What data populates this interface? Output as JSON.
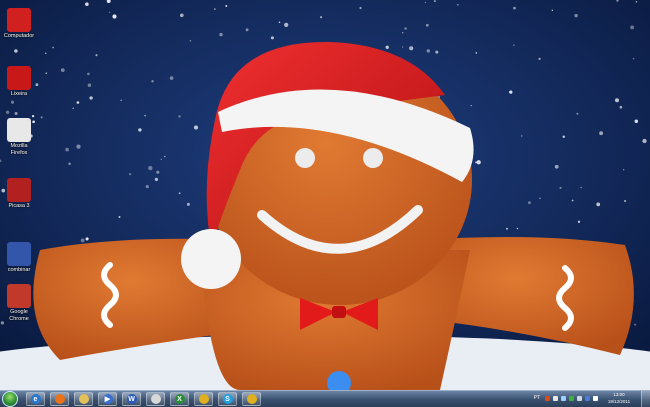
{
  "desktop": {
    "icons": [
      {
        "label": "Computador",
        "icon": "computer-icon",
        "color": "#d02020"
      },
      {
        "label": "Lixeira",
        "icon": "recycle-bin-icon",
        "color": "#c81818"
      },
      {
        "label": "Mozilla Firefox",
        "icon": "firefox-candy-cane-icon",
        "color": "#e8e8e8"
      },
      {
        "label": "Picasa 3",
        "icon": "picasa-icon",
        "color": "#b32020"
      },
      {
        "label": "combinar",
        "icon": "combinar-icon",
        "color": "#3355aa"
      },
      {
        "label": "Google Chrome",
        "icon": "gift-box-icon",
        "color": "#c0392b"
      }
    ]
  },
  "taskbar": {
    "pinned": [
      {
        "name": "ie-icon",
        "glyph": "e",
        "color": "#2a78d0"
      },
      {
        "name": "firefox-icon",
        "glyph": "",
        "color": "#e8731a"
      },
      {
        "name": "explorer-icon",
        "glyph": "",
        "color": "#e3c15a"
      },
      {
        "name": "media-player-icon",
        "glyph": "▶",
        "color": "#3a6fd0"
      },
      {
        "name": "word-icon",
        "glyph": "W",
        "color": "#2b5ab8"
      },
      {
        "name": "picasa-icon",
        "glyph": "",
        "color": "#d8d8d8"
      },
      {
        "name": "excel-icon",
        "glyph": "X",
        "color": "#2a8a3a"
      },
      {
        "name": "chrome-icon",
        "glyph": "",
        "color": "#e0b020"
      },
      {
        "name": "skype-icon",
        "glyph": "S",
        "color": "#21a0e0"
      },
      {
        "name": "chrome-icon-2",
        "glyph": "",
        "color": "#e0b020"
      }
    ],
    "tray_language": "PT",
    "clock_time": "13:00",
    "clock_date": "19/12/2011"
  }
}
